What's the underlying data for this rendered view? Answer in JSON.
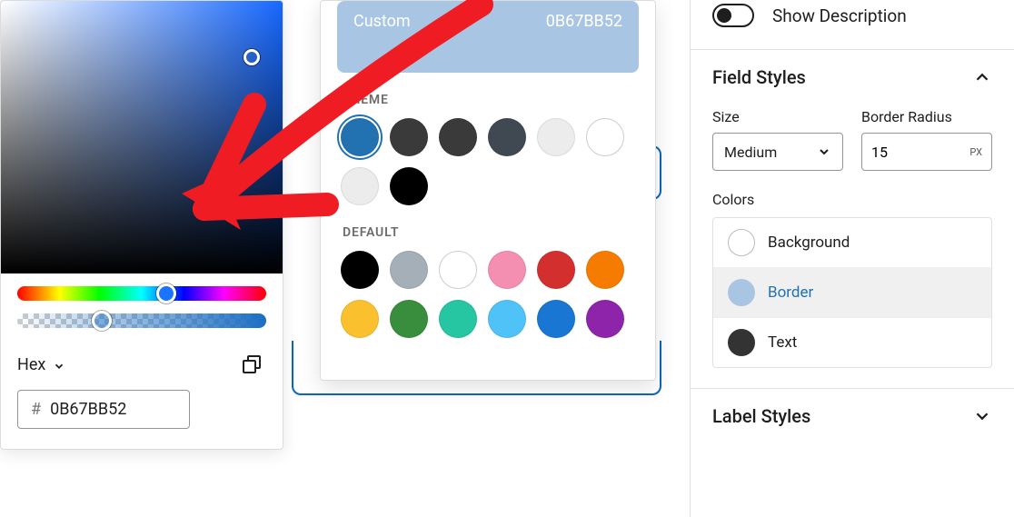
{
  "picker": {
    "format_label": "Hex",
    "hex_prefix": "#",
    "hex_value": "0B67BB52"
  },
  "swatches": {
    "custom_label": "Custom",
    "custom_value": "0B67BB52",
    "theme_label": "THEME",
    "default_label": "DEFAULT",
    "theme_colors": [
      "#2271b1",
      "#3a3a3a",
      "#3a3a3a",
      "#404852",
      "#ececec",
      "#ffffff",
      "#ececec",
      "#000000"
    ],
    "default_colors": [
      "#000000",
      "#a4afb7",
      "#ffffff",
      "#f48fb1",
      "#d32f2f",
      "#f57c00",
      "#fbc02d",
      "#388e3c",
      "#26c6a3",
      "#4fc3f7",
      "#1976d2",
      "#8e24aa"
    ]
  },
  "sidebar": {
    "show_description_label": "Show Description",
    "field_styles_title": "Field Styles",
    "size_label": "Size",
    "size_value": "Medium",
    "border_radius_label": "Border Radius",
    "border_radius_value": "15",
    "border_radius_unit": "PX",
    "colors_label": "Colors",
    "color_rows": {
      "background": "Background",
      "border": "Border",
      "text": "Text"
    },
    "label_styles_title": "Label Styles"
  }
}
